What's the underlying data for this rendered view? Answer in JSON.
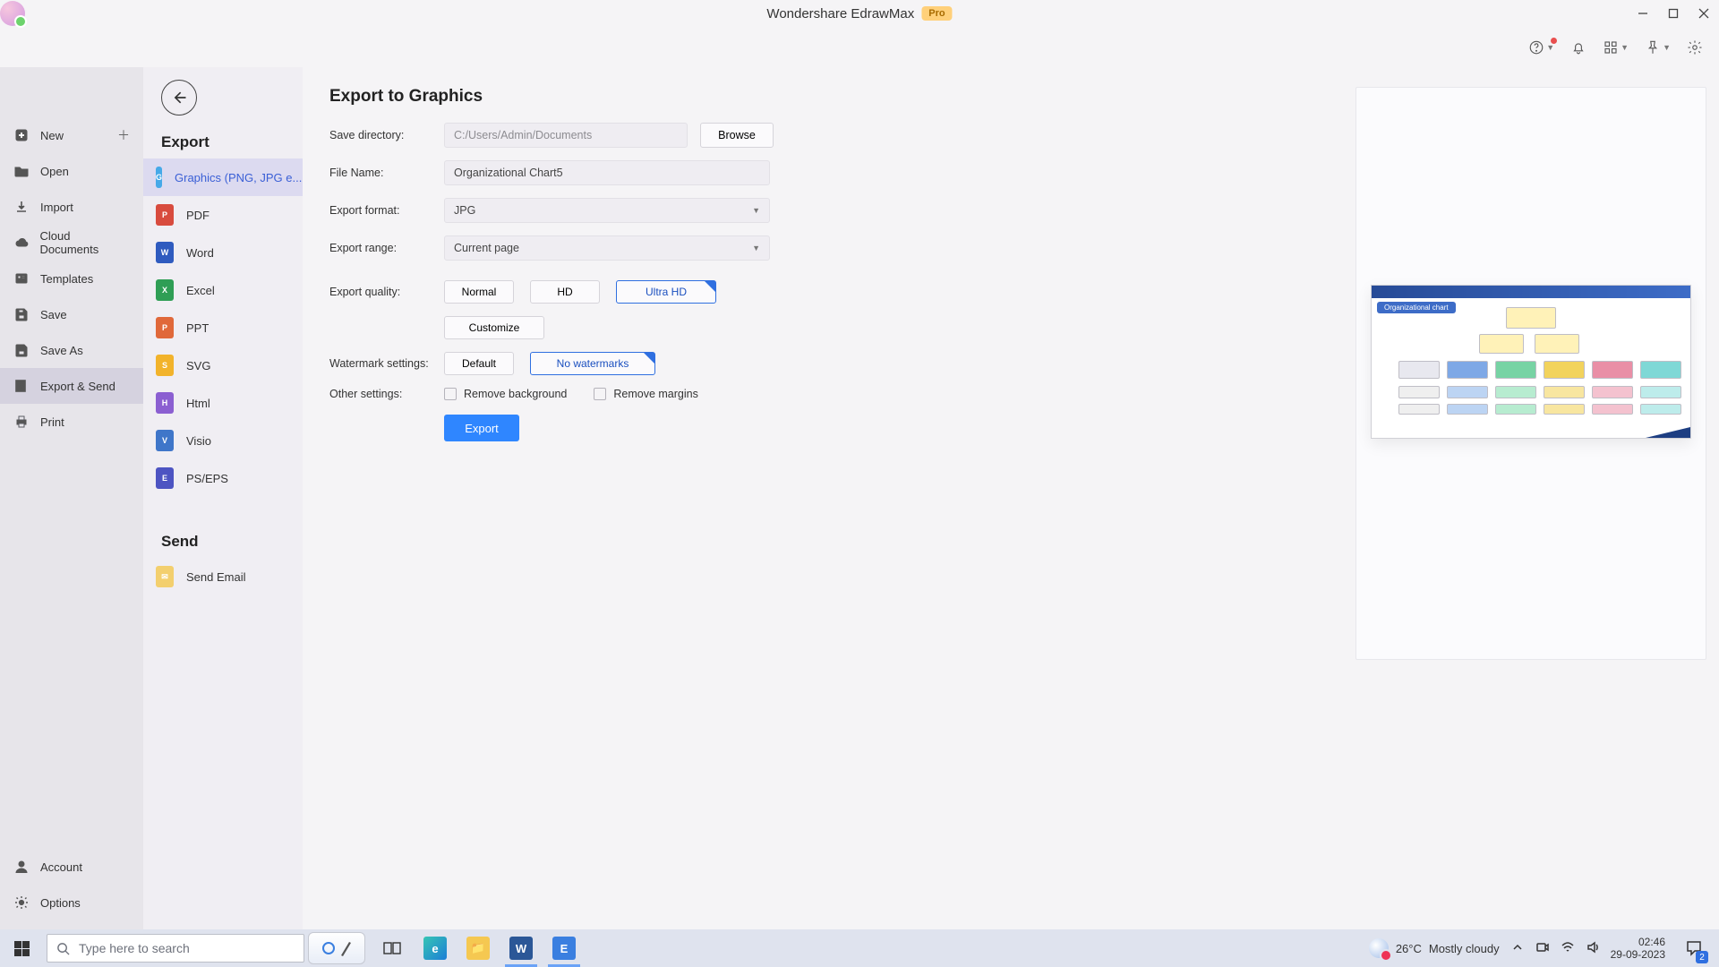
{
  "app": {
    "title": "Wondershare EdrawMax",
    "badge": "Pro"
  },
  "left_rail": {
    "items": [
      {
        "id": "new",
        "label": "New",
        "plus": true
      },
      {
        "id": "open",
        "label": "Open"
      },
      {
        "id": "import",
        "label": "Import"
      },
      {
        "id": "cloud",
        "label": "Cloud Documents"
      },
      {
        "id": "templates",
        "label": "Templates"
      },
      {
        "id": "save",
        "label": "Save"
      },
      {
        "id": "saveas",
        "label": "Save As"
      },
      {
        "id": "export",
        "label": "Export & Send"
      },
      {
        "id": "print",
        "label": "Print"
      }
    ],
    "active": "export",
    "footer": [
      {
        "id": "account",
        "label": "Account"
      },
      {
        "id": "options",
        "label": "Options"
      }
    ]
  },
  "mid": {
    "heading_export": "Export",
    "heading_send": "Send",
    "formats": [
      {
        "id": "graphics",
        "label": "Graphics (PNG, JPG e...",
        "color": "#46a9e8",
        "mark": "G"
      },
      {
        "id": "pdf",
        "label": "PDF",
        "color": "#d84b3e",
        "mark": "P"
      },
      {
        "id": "word",
        "label": "Word",
        "color": "#2f5bbf",
        "mark": "W"
      },
      {
        "id": "excel",
        "label": "Excel",
        "color": "#2f9e55",
        "mark": "X"
      },
      {
        "id": "ppt",
        "label": "PPT",
        "color": "#e0683a",
        "mark": "P"
      },
      {
        "id": "svg",
        "label": "SVG",
        "color": "#f2b32b",
        "mark": "S"
      },
      {
        "id": "html",
        "label": "Html",
        "color": "#8b5fd1",
        "mark": "H"
      },
      {
        "id": "visio",
        "label": "Visio",
        "color": "#3f76c9",
        "mark": "V"
      },
      {
        "id": "ps",
        "label": "PS/EPS",
        "color": "#4d54c2",
        "mark": "E"
      }
    ],
    "formats_active": "graphics",
    "send": [
      {
        "id": "email",
        "label": "Send Email"
      }
    ]
  },
  "form": {
    "title": "Export to Graphics",
    "labels": {
      "dir": "Save directory:",
      "name": "File Name:",
      "format": "Export format:",
      "range": "Export range:",
      "quality": "Export quality:",
      "watermark": "Watermark settings:",
      "other": "Other settings:"
    },
    "dir_value": "C:/Users/Admin/Documents",
    "browse": "Browse",
    "name_value": "Organizational Chart5",
    "format_value": "JPG",
    "range_value": "Current page",
    "quality": {
      "options": [
        "Normal",
        "HD",
        "Ultra HD"
      ],
      "selected": "Ultra HD",
      "customize": "Customize"
    },
    "watermark": {
      "options": [
        "Default",
        "No watermarks"
      ],
      "selected": "No watermarks"
    },
    "other": {
      "remove_bg": "Remove background",
      "remove_margins": "Remove margins"
    },
    "export_btn": "Export"
  },
  "preview": {
    "caption": "Organizational chart"
  },
  "taskbar": {
    "search_placeholder": "Type here to search",
    "weather": {
      "temp": "26°C",
      "desc": "Mostly cloudy"
    },
    "clock": {
      "time": "02:46",
      "date": "29-09-2023"
    },
    "notif_count": "2"
  }
}
